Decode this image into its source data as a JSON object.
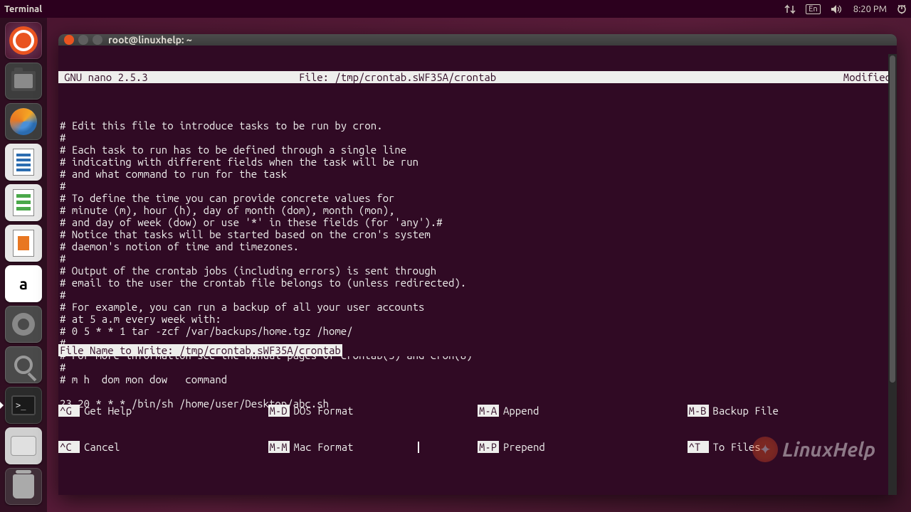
{
  "top_panel": {
    "title": "Terminal",
    "lang": "En",
    "time": "8:20 PM"
  },
  "window": {
    "title": "root@linuxhelp: ~"
  },
  "nano": {
    "version": "GNU nano 2.5.3",
    "file_label": "File: /tmp/crontab.sWF35A/crontab",
    "status": "Modified",
    "content": "\n# Edit this file to introduce tasks to be run by cron.\n#\n# Each task to run has to be defined through a single line\n# indicating with different fields when the task will be run\n# and what command to run for the task\n#\n# To define the time you can provide concrete values for\n# minute (m), hour (h), day of month (dom), month (mon),\n# and day of week (dow) or use '*' in these fields (for 'any').#\n# Notice that tasks will be started based on the cron's system\n# daemon's notion of time and timezones.\n#\n# Output of the crontab jobs (including errors) is sent through\n# email to the user the crontab file belongs to (unless redirected).\n#\n# For example, you can run a backup of all your user accounts\n# at 5 a.m every week with:\n# 0 5 * * 1 tar -zcf /var/backups/home.tgz /home/\n#\n# For more information see the manual pages of crontab(5) and cron(8)\n#\n# m h  dom mon dow   command\n\n23 20 * * * /bin/sh /home/user/Desktop/abc.sh",
    "write_prompt": "File Name to Write: /tmp/crontab.sWF35A/crontab",
    "shortcuts_row1": [
      {
        "key": "^G",
        "desc": "Get Help"
      },
      {
        "key": "M-D",
        "desc": "DOS Format"
      },
      {
        "key": "M-A",
        "desc": "Append"
      },
      {
        "key": "M-B",
        "desc": "Backup File"
      }
    ],
    "shortcuts_row2": [
      {
        "key": "^C",
        "desc": "Cancel"
      },
      {
        "key": "M-M",
        "desc": "Mac Format"
      },
      {
        "key": "M-P",
        "desc": "Prepend"
      },
      {
        "key": "^T",
        "desc": "To Files"
      }
    ]
  },
  "watermark": "LinuxHelp"
}
